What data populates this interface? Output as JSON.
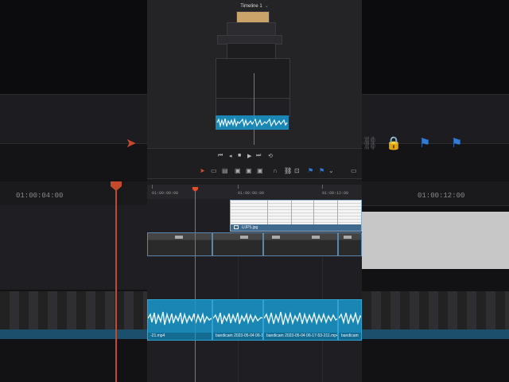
{
  "viewer": {
    "title": "Timeline 1",
    "chevron": "⌄"
  },
  "transport": {
    "icons": [
      "skip-back-icon",
      "step-back-icon",
      "stop-icon",
      "play-icon",
      "skip-forward-icon",
      "loop-icon"
    ],
    "glyphs": [
      "⏮",
      "◂",
      "■",
      "▶",
      "⏭",
      "⟲"
    ]
  },
  "ruler": {
    "timecodes": [
      "01:00:00:00",
      "01:00:08:00",
      "01:00:12:00"
    ]
  },
  "background": {
    "timecodes_left": [
      "01:00:04:00"
    ],
    "timecodes_right": [
      "01:00:12:00"
    ]
  },
  "clips": {
    "still_image_name": "UJP5.jpg",
    "audio_clip_names": [
      "-21.mp4",
      "bandicam 2023-05-04 06-17-5...",
      "bandicam 2023-05-04 06-17-53-211.mp4",
      "bandicam"
    ]
  },
  "colors": {
    "playhead": "#e0512f",
    "audio_clip": "#1a86b4",
    "video_clip": "#3b6a8f",
    "flag_blue": "#2f7bd6"
  }
}
